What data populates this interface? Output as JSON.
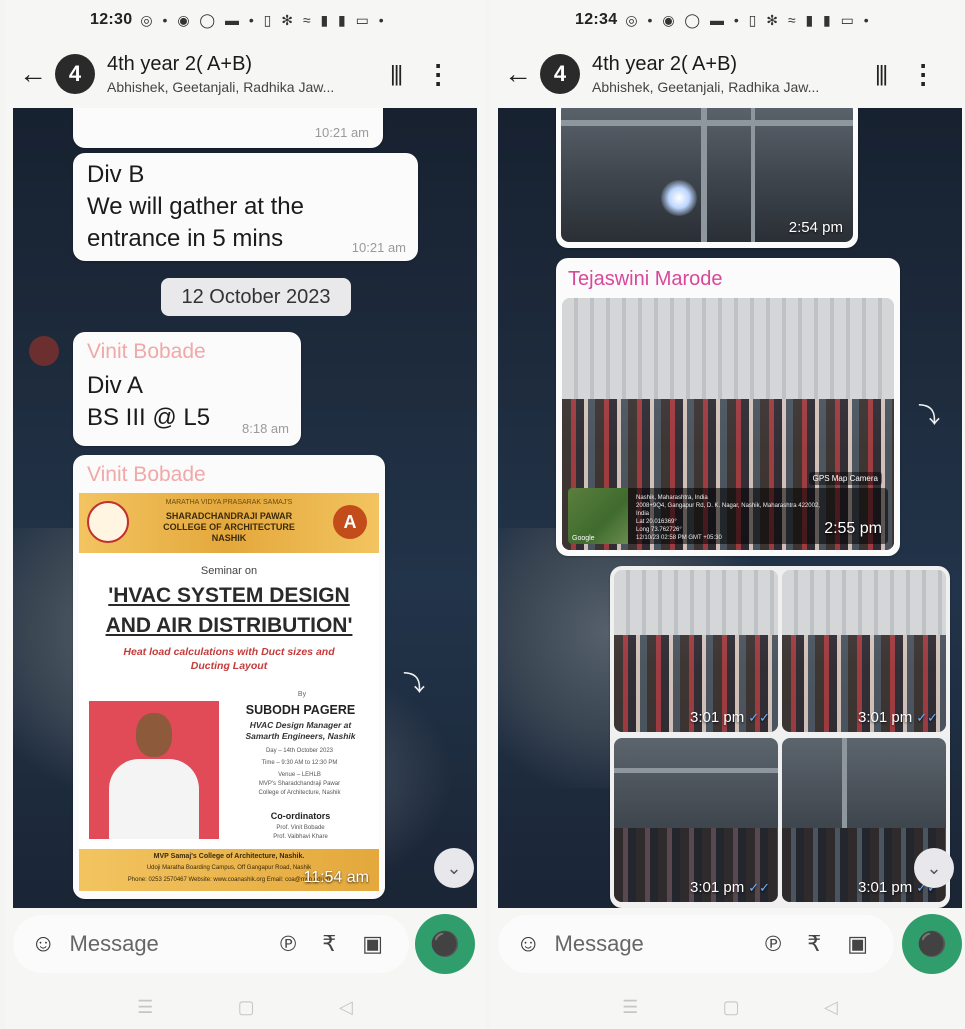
{
  "left": {
    "status": {
      "time": "12:30",
      "icons": "◎ • ◉ ◯ ▬ • ▯ ✻ ≈ ▮ ▮ ▭ •",
      "battery": "61"
    },
    "header": {
      "avatar_num": "4",
      "title": "4th year 2(          A+B)",
      "members": "Abhishek, Geetanjali, Radhika Jaw..."
    },
    "messages": {
      "m1_time": "10:21 am",
      "m2_line1": "Div B",
      "m2_line2": "We will gather at the",
      "m2_line3": "entrance in 5 mins",
      "m2_time": "10:21 am",
      "date_chip": "12 October 2023",
      "m3_sender": "Vinit Bobade",
      "m3_line1": "Div A",
      "m3_line2": "BS III @ L5",
      "m3_time": "8:18 am",
      "m4_sender": "Vinit Bobade",
      "m4_time": "11:54 am"
    },
    "poster": {
      "org": "MARATHA VIDYA PRASARAK SAMAJ'S",
      "college_1": "SHARADCHANDRAJI PAWAR",
      "college_2": "COLLEGE OF ARCHITECTURE",
      "college_3": "NASHIK",
      "grade": "A",
      "seminar_on": "Seminar on",
      "title_1": "'HVAC SYSTEM DESIGN",
      "title_2": "AND AIR DISTRIBUTION'",
      "subtitle_1": "Heat load calculations with Duct sizes and",
      "subtitle_2": "Ducting Layout",
      "by": "By",
      "speaker": "SUBODH PAGERE",
      "role_1": "HVAC Design Manager at",
      "role_2": "Samarth Engineers, Nashik",
      "day": "Day – 14th October 2023",
      "time": "Time – 9:30 AM to 12:30 PM",
      "venue_1": "Venue – LEHLB",
      "venue_2": "MVP's Sharadchandraji Pawar",
      "venue_3": "College of Architecture, Nashik",
      "coord_heading": "Co-ordinators",
      "coord_1": "Prof. Vinit Bobade",
      "coord_2": "Prof. Vaibhavi Khare",
      "footer_1": "MVP Samaj's College of Architecture, Nashik.",
      "footer_2": "Udoji Maratha Boarding Campus, Off Gangapur Road, Nashik",
      "footer_3": "Phone: 0253 2570467    Website: www.coanashik.org    Email: coa@mvp.edu.in"
    },
    "composer": {
      "placeholder": "Message"
    }
  },
  "right": {
    "status": {
      "time": "12:34",
      "icons": "◎ • ◉ ◯ ▬ • ▯ ✻ ≈ ▮ ▮ ▭ •",
      "battery": "61"
    },
    "header": {
      "avatar_num": "4",
      "title": "4th year 2(          A+B)",
      "members": "Abhishek, Geetanjali, Radhika Jaw..."
    },
    "messages": {
      "photo1_time": "2:54 pm",
      "m2_sender": "Tejaswini Marode",
      "m2_time": "2:55 pm",
      "geo_label": "GPS Map Camera",
      "geo_place": "Nashik, Maharashtra, India",
      "geo_address": "2008+9Q4, Gangapur Rd, D. K. Nagar, Nashik, Maharashtra 422002, India",
      "geo_lat": "Lat 20.016369°",
      "geo_long": "Long 73.762726°",
      "geo_date": "12/10/23 02:58 PM GMT +05:30",
      "geo_google": "Google",
      "grid_time_1": "3:01 pm",
      "grid_time_2": "3:01 pm",
      "grid_time_3": "3:01 pm",
      "grid_time_4": "3:01 pm"
    },
    "composer": {
      "placeholder": "Message"
    }
  },
  "colors": {
    "accent": "#2f9e6c",
    "sender_left": "#f0a8a8",
    "sender_right": "#d9479a",
    "ticks": "#6fb2ff"
  }
}
